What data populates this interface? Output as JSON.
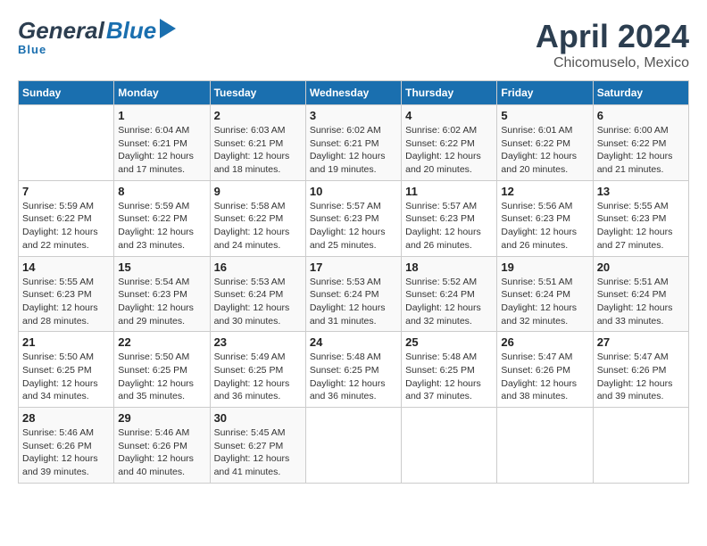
{
  "header": {
    "logo_general": "General",
    "logo_blue": "Blue",
    "title": "April 2024",
    "subtitle": "Chicomuselo, Mexico"
  },
  "weekdays": [
    "Sunday",
    "Monday",
    "Tuesday",
    "Wednesday",
    "Thursday",
    "Friday",
    "Saturday"
  ],
  "weeks": [
    [
      {
        "day": "",
        "sunrise": "",
        "sunset": "",
        "daylight": ""
      },
      {
        "day": "1",
        "sunrise": "Sunrise: 6:04 AM",
        "sunset": "Sunset: 6:21 PM",
        "daylight": "Daylight: 12 hours and 17 minutes."
      },
      {
        "day": "2",
        "sunrise": "Sunrise: 6:03 AM",
        "sunset": "Sunset: 6:21 PM",
        "daylight": "Daylight: 12 hours and 18 minutes."
      },
      {
        "day": "3",
        "sunrise": "Sunrise: 6:02 AM",
        "sunset": "Sunset: 6:21 PM",
        "daylight": "Daylight: 12 hours and 19 minutes."
      },
      {
        "day": "4",
        "sunrise": "Sunrise: 6:02 AM",
        "sunset": "Sunset: 6:22 PM",
        "daylight": "Daylight: 12 hours and 20 minutes."
      },
      {
        "day": "5",
        "sunrise": "Sunrise: 6:01 AM",
        "sunset": "Sunset: 6:22 PM",
        "daylight": "Daylight: 12 hours and 20 minutes."
      },
      {
        "day": "6",
        "sunrise": "Sunrise: 6:00 AM",
        "sunset": "Sunset: 6:22 PM",
        "daylight": "Daylight: 12 hours and 21 minutes."
      }
    ],
    [
      {
        "day": "7",
        "sunrise": "Sunrise: 5:59 AM",
        "sunset": "Sunset: 6:22 PM",
        "daylight": "Daylight: 12 hours and 22 minutes."
      },
      {
        "day": "8",
        "sunrise": "Sunrise: 5:59 AM",
        "sunset": "Sunset: 6:22 PM",
        "daylight": "Daylight: 12 hours and 23 minutes."
      },
      {
        "day": "9",
        "sunrise": "Sunrise: 5:58 AM",
        "sunset": "Sunset: 6:22 PM",
        "daylight": "Daylight: 12 hours and 24 minutes."
      },
      {
        "day": "10",
        "sunrise": "Sunrise: 5:57 AM",
        "sunset": "Sunset: 6:23 PM",
        "daylight": "Daylight: 12 hours and 25 minutes."
      },
      {
        "day": "11",
        "sunrise": "Sunrise: 5:57 AM",
        "sunset": "Sunset: 6:23 PM",
        "daylight": "Daylight: 12 hours and 26 minutes."
      },
      {
        "day": "12",
        "sunrise": "Sunrise: 5:56 AM",
        "sunset": "Sunset: 6:23 PM",
        "daylight": "Daylight: 12 hours and 26 minutes."
      },
      {
        "day": "13",
        "sunrise": "Sunrise: 5:55 AM",
        "sunset": "Sunset: 6:23 PM",
        "daylight": "Daylight: 12 hours and 27 minutes."
      }
    ],
    [
      {
        "day": "14",
        "sunrise": "Sunrise: 5:55 AM",
        "sunset": "Sunset: 6:23 PM",
        "daylight": "Daylight: 12 hours and 28 minutes."
      },
      {
        "day": "15",
        "sunrise": "Sunrise: 5:54 AM",
        "sunset": "Sunset: 6:23 PM",
        "daylight": "Daylight: 12 hours and 29 minutes."
      },
      {
        "day": "16",
        "sunrise": "Sunrise: 5:53 AM",
        "sunset": "Sunset: 6:24 PM",
        "daylight": "Daylight: 12 hours and 30 minutes."
      },
      {
        "day": "17",
        "sunrise": "Sunrise: 5:53 AM",
        "sunset": "Sunset: 6:24 PM",
        "daylight": "Daylight: 12 hours and 31 minutes."
      },
      {
        "day": "18",
        "sunrise": "Sunrise: 5:52 AM",
        "sunset": "Sunset: 6:24 PM",
        "daylight": "Daylight: 12 hours and 32 minutes."
      },
      {
        "day": "19",
        "sunrise": "Sunrise: 5:51 AM",
        "sunset": "Sunset: 6:24 PM",
        "daylight": "Daylight: 12 hours and 32 minutes."
      },
      {
        "day": "20",
        "sunrise": "Sunrise: 5:51 AM",
        "sunset": "Sunset: 6:24 PM",
        "daylight": "Daylight: 12 hours and 33 minutes."
      }
    ],
    [
      {
        "day": "21",
        "sunrise": "Sunrise: 5:50 AM",
        "sunset": "Sunset: 6:25 PM",
        "daylight": "Daylight: 12 hours and 34 minutes."
      },
      {
        "day": "22",
        "sunrise": "Sunrise: 5:50 AM",
        "sunset": "Sunset: 6:25 PM",
        "daylight": "Daylight: 12 hours and 35 minutes."
      },
      {
        "day": "23",
        "sunrise": "Sunrise: 5:49 AM",
        "sunset": "Sunset: 6:25 PM",
        "daylight": "Daylight: 12 hours and 36 minutes."
      },
      {
        "day": "24",
        "sunrise": "Sunrise: 5:48 AM",
        "sunset": "Sunset: 6:25 PM",
        "daylight": "Daylight: 12 hours and 36 minutes."
      },
      {
        "day": "25",
        "sunrise": "Sunrise: 5:48 AM",
        "sunset": "Sunset: 6:25 PM",
        "daylight": "Daylight: 12 hours and 37 minutes."
      },
      {
        "day": "26",
        "sunrise": "Sunrise: 5:47 AM",
        "sunset": "Sunset: 6:26 PM",
        "daylight": "Daylight: 12 hours and 38 minutes."
      },
      {
        "day": "27",
        "sunrise": "Sunrise: 5:47 AM",
        "sunset": "Sunset: 6:26 PM",
        "daylight": "Daylight: 12 hours and 39 minutes."
      }
    ],
    [
      {
        "day": "28",
        "sunrise": "Sunrise: 5:46 AM",
        "sunset": "Sunset: 6:26 PM",
        "daylight": "Daylight: 12 hours and 39 minutes."
      },
      {
        "day": "29",
        "sunrise": "Sunrise: 5:46 AM",
        "sunset": "Sunset: 6:26 PM",
        "daylight": "Daylight: 12 hours and 40 minutes."
      },
      {
        "day": "30",
        "sunrise": "Sunrise: 5:45 AM",
        "sunset": "Sunset: 6:27 PM",
        "daylight": "Daylight: 12 hours and 41 minutes."
      },
      {
        "day": "",
        "sunrise": "",
        "sunset": "",
        "daylight": ""
      },
      {
        "day": "",
        "sunrise": "",
        "sunset": "",
        "daylight": ""
      },
      {
        "day": "",
        "sunrise": "",
        "sunset": "",
        "daylight": ""
      },
      {
        "day": "",
        "sunrise": "",
        "sunset": "",
        "daylight": ""
      }
    ]
  ]
}
